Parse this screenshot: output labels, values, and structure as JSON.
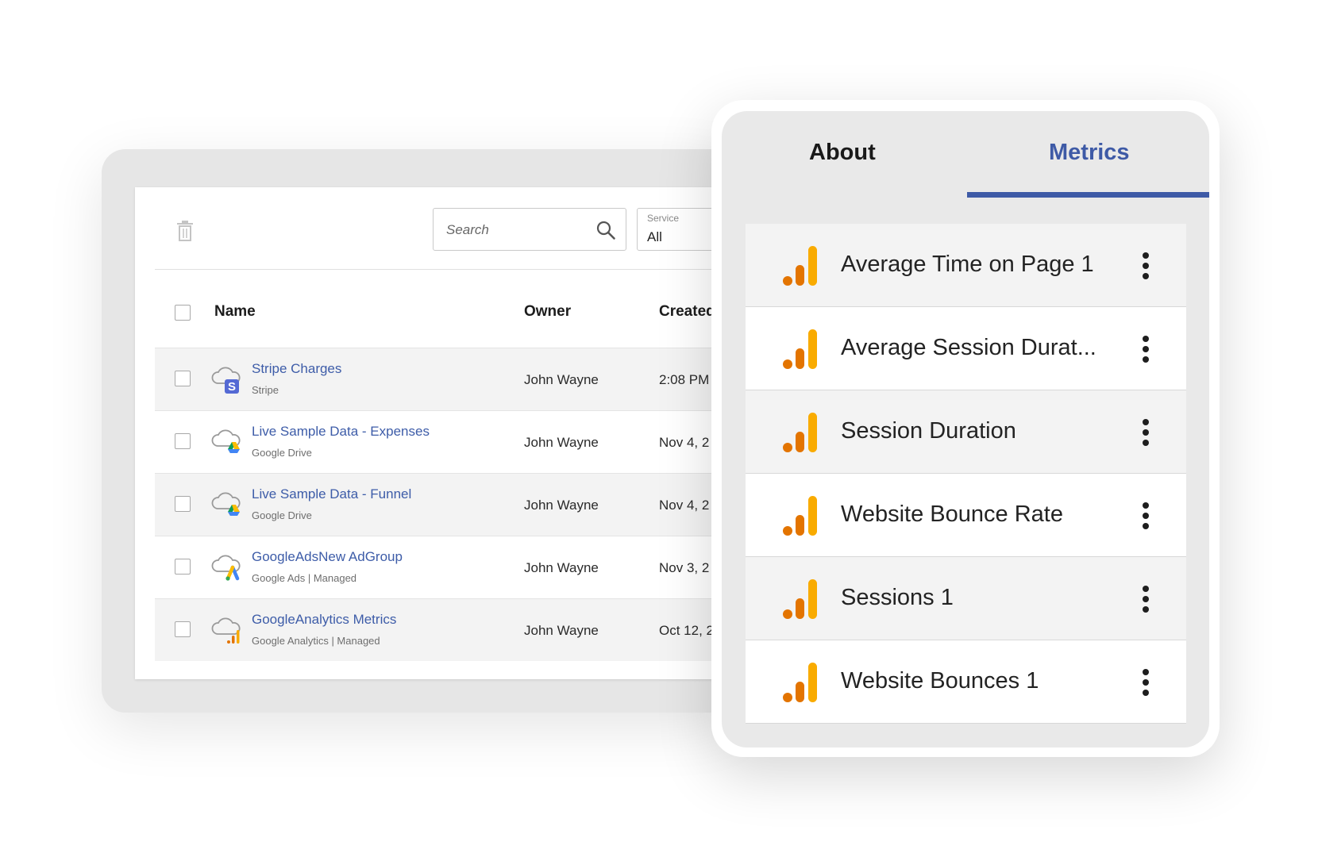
{
  "toolbar": {
    "search_placeholder": "Search",
    "service_label": "Service",
    "service_value": "All"
  },
  "table": {
    "headers": {
      "name": "Name",
      "owner": "Owner",
      "created": "Created"
    },
    "rows": [
      {
        "name": "Stripe Charges",
        "sub": "Stripe",
        "owner": "John Wayne",
        "created": "2:08 PM",
        "service_icon": "stripe-icon"
      },
      {
        "name": "Live Sample Data - Expenses",
        "sub": "Google Drive",
        "owner": "John Wayne",
        "created": "Nov 4, 2",
        "service_icon": "google-drive-icon"
      },
      {
        "name": "Live Sample Data - Funnel",
        "sub": "Google Drive",
        "owner": "John Wayne",
        "created": "Nov 4, 2",
        "service_icon": "google-drive-icon"
      },
      {
        "name": "GoogleAdsNew AdGroup",
        "sub": "Google Ads | Managed",
        "owner": "John Wayne",
        "created": "Nov 3, 2",
        "service_icon": "google-ads-icon"
      },
      {
        "name": "GoogleAnalytics Metrics",
        "sub": "Google Analytics | Managed",
        "owner": "John Wayne",
        "created": "Oct 12, 2",
        "service_icon": "google-analytics-icon"
      }
    ]
  },
  "panel": {
    "tabs": {
      "about": "About",
      "metrics": "Metrics"
    },
    "active_tab": "Metrics",
    "metrics": [
      {
        "label": "Average Time on Page 1"
      },
      {
        "label": "Average Session Durat..."
      },
      {
        "label": "Session Duration"
      },
      {
        "label": "Website Bounce Rate"
      },
      {
        "label": "Sessions 1"
      },
      {
        "label": "Website Bounces 1"
      }
    ]
  },
  "colors": {
    "accent": "#3e5aa6",
    "link": "#3d5ca8",
    "ga_orange_dark": "#e37400",
    "ga_orange_light": "#f9ab00"
  }
}
